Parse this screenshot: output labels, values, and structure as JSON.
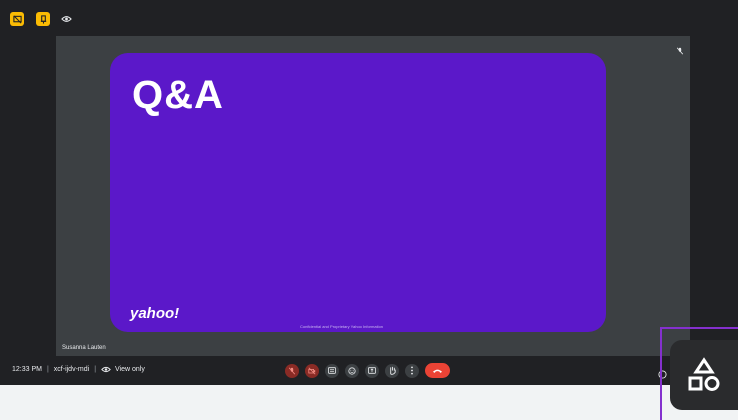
{
  "slide": {
    "title": "Q&A",
    "logo": "yahoo!",
    "footer": "Confidential and Proprietary Yahoo Information"
  },
  "participant": {
    "name": "Susanna Lauten"
  },
  "bottom_bar": {
    "time": "12:33 PM",
    "meeting_code": "xcf-ijdv-mdi",
    "view_mode": "View only"
  },
  "colors": {
    "slide_bg": "#5b18c9",
    "accent_yellow": "#fbbc04",
    "end_call_red": "#ea4335",
    "highlight_purple": "#8430ce"
  },
  "icons": {
    "top_left": [
      "presentation-icon",
      "pin-icon",
      "eye-icon"
    ],
    "controls": [
      "mic-off-icon",
      "camera-off-icon",
      "captions-icon",
      "emoji-icon",
      "present-icon",
      "raise-hand-icon",
      "more-options-icon",
      "end-call-icon"
    ],
    "activities": "shapes-icon"
  }
}
